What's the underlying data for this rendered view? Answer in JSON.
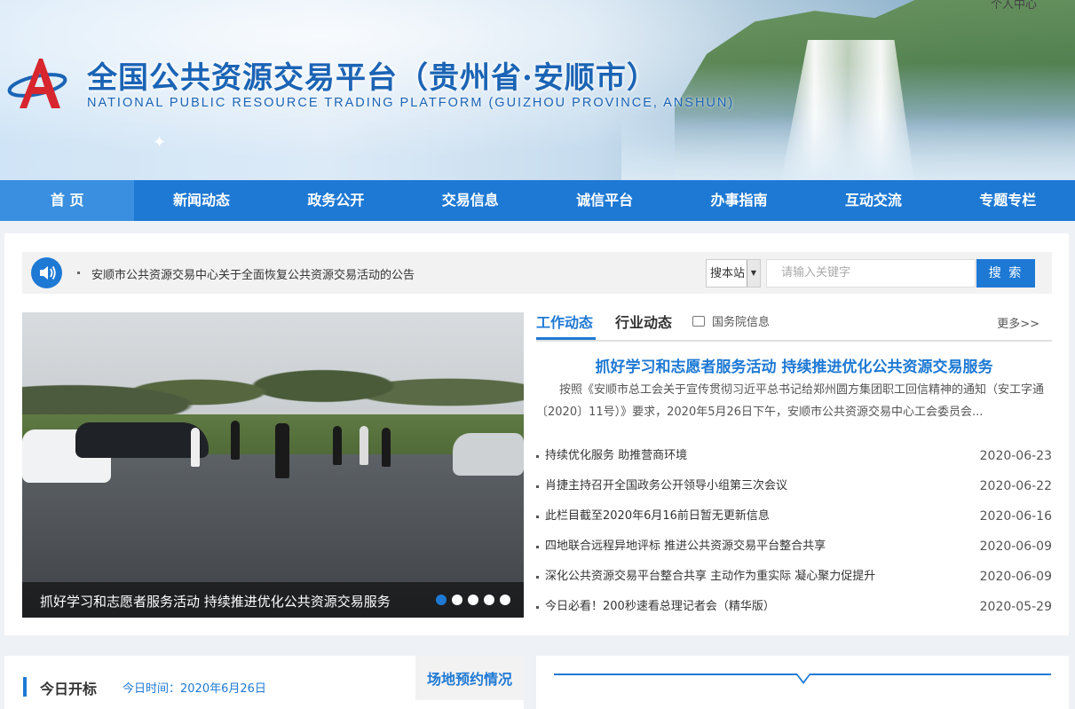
{
  "header": {
    "title_cn": "全国公共资源交易平台（贵州省·安顺市）",
    "title_en": "NATIONAL PUBLIC RESOURCE TRADING PLATFORM (GUIZHOU PROVINCE, ANSHUN)",
    "personal_link": "个人中心"
  },
  "nav": {
    "items": [
      "首 页",
      "新闻动态",
      "政务公开",
      "交易信息",
      "诚信平台",
      "办事指南",
      "互动交流",
      "专题专栏"
    ]
  },
  "notice": {
    "text": "安顺市公共资源交易中心关于全面恢复公共资源交易活动的公告"
  },
  "search": {
    "scope": "搜本站",
    "placeholder": "请输入关键字",
    "button": "搜 索"
  },
  "slideshow": {
    "caption": "抓好学习和志愿者服务活动 持续推进优化公共资源交易服务",
    "dot_count": 5,
    "active_index": 0
  },
  "news": {
    "tab_active": "工作动态",
    "tab_2": "行业动态",
    "tab_3": "国务院信息",
    "more": "更多>>",
    "headline": "抓好学习和志愿者服务活动 持续推进优化公共资源交易服务",
    "summary": "按照《安顺市总工会关于宣传贯彻习近平总书记给郑州圆方集团职工回信精神的通知（安工字通〔2020〕11号）》要求，2020年5月26日下午，安顺市公共资源交易中心工会委员会...",
    "items": [
      {
        "title": "持续优化服务 助推营商环境",
        "date": "2020-06-23"
      },
      {
        "title": "肖捷主持召开全国政务公开领导小组第三次会议",
        "date": "2020-06-22"
      },
      {
        "title": "此栏目截至2020年6月16前日暂无更新信息",
        "date": "2020-06-16"
      },
      {
        "title": "四地联合远程异地评标 推进公共资源交易平台整合共享",
        "date": "2020-06-09"
      },
      {
        "title": "深化公共资源交易平台整合共享 主动作为重实际 凝心聚力促提升",
        "date": "2020-06-09"
      },
      {
        "title": "今日必看！200秒速看总理记者会（精华版）",
        "date": "2020-05-29"
      }
    ]
  },
  "today": {
    "title": "今日开标",
    "date_text": "今日时间：2020年6月26日",
    "venue_tab": "场地预约情况"
  },
  "colors": {
    "primary": "#1e79d4",
    "nav_active": "#3a8fe0",
    "title_blue": "#1b64b5"
  }
}
